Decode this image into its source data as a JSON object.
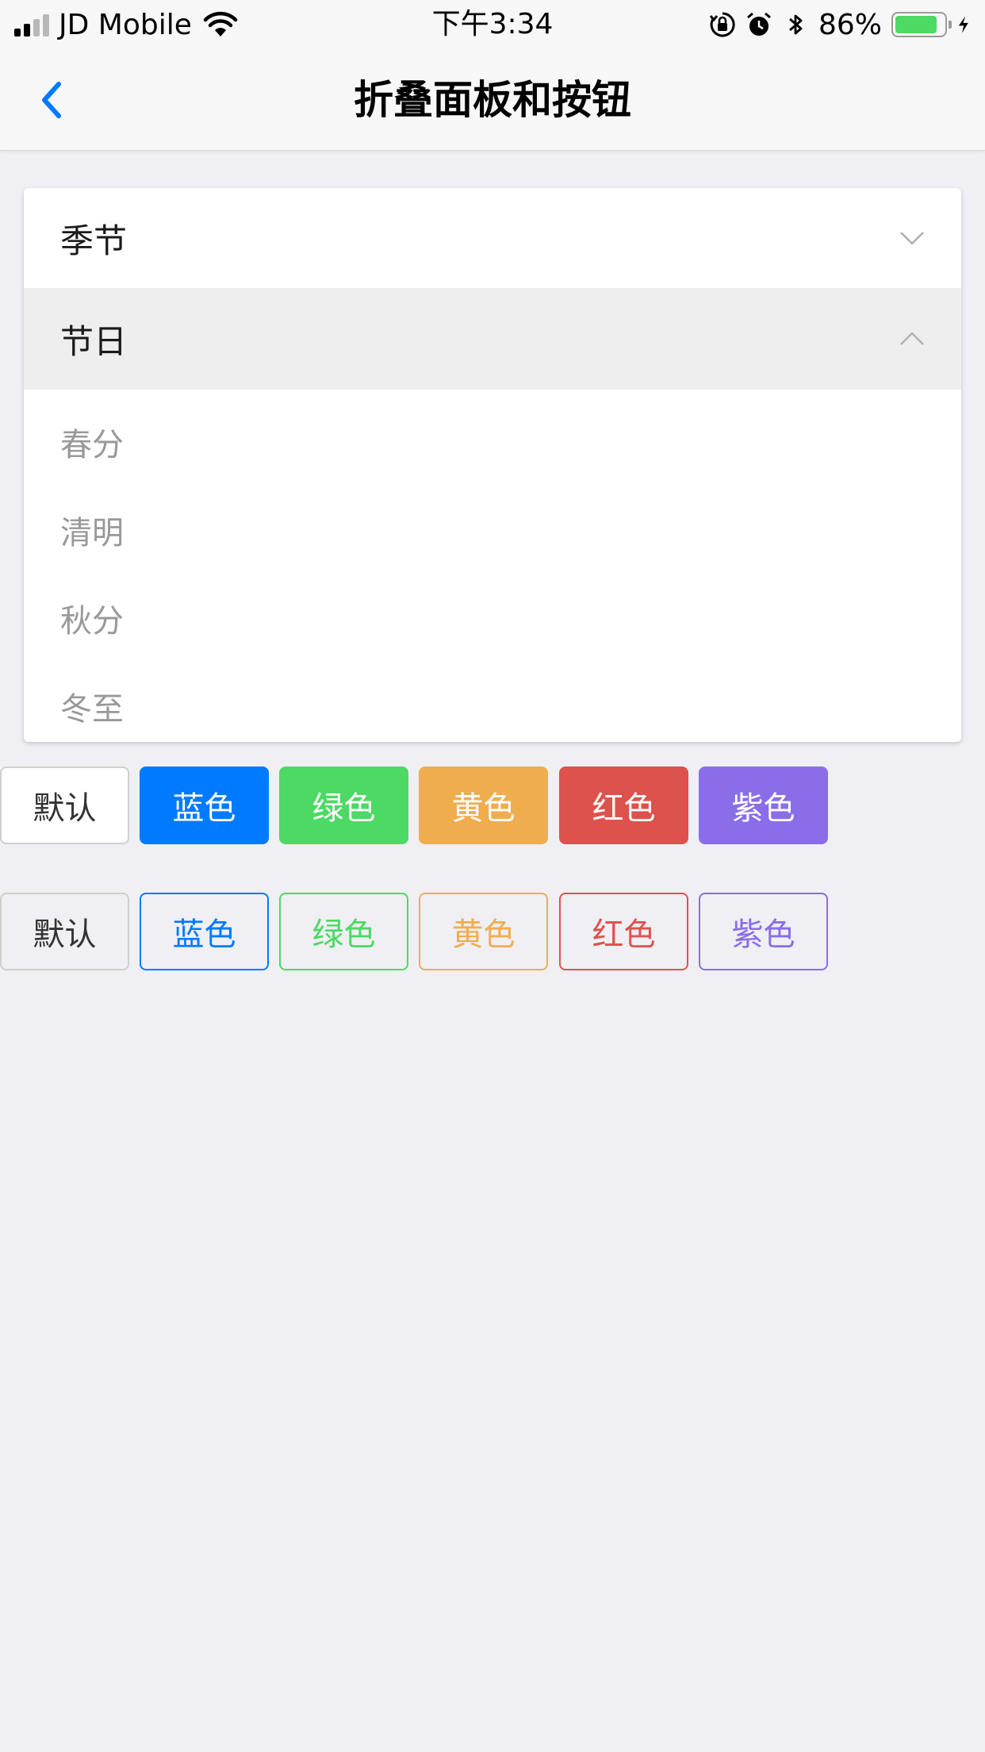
{
  "status_bar": {
    "carrier": "JD Mobile",
    "time": "下午3:34",
    "battery_percent": "86%",
    "battery_level": 0.86,
    "icons": [
      "signal-icon",
      "wifi-icon",
      "orientation-lock-icon",
      "alarm-icon",
      "bluetooth-icon",
      "battery-icon",
      "charging-icon"
    ]
  },
  "nav": {
    "title": "折叠面板和按钮",
    "back_icon": "chevron-left-icon"
  },
  "collapse": {
    "sections": [
      {
        "label": "季节",
        "expanded": false,
        "icon": "chevron-down-icon"
      },
      {
        "label": "节日",
        "expanded": true,
        "icon": "chevron-up-icon"
      }
    ],
    "items": [
      "春分",
      "清明",
      "秋分",
      "冬至"
    ]
  },
  "buttons": {
    "filled": [
      "默认",
      "蓝色",
      "绿色",
      "黄色",
      "红色",
      "紫色"
    ],
    "outline": [
      "默认",
      "蓝色",
      "绿色",
      "黄色",
      "红色",
      "紫色"
    ]
  },
  "colors": {
    "blue": "#007aff",
    "green": "#4cd964",
    "yellow": "#f0ad4e",
    "red": "#dd524d",
    "purple": "#8a6de9",
    "background": "#efeff4"
  }
}
